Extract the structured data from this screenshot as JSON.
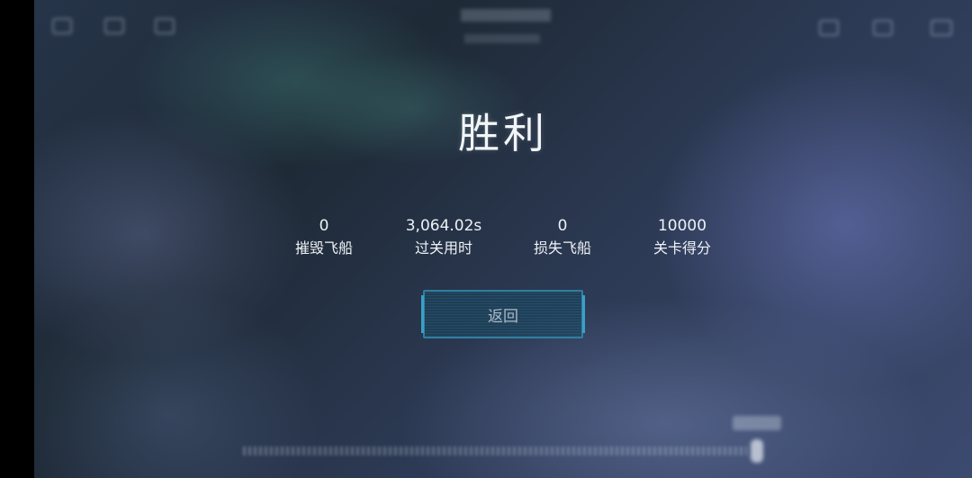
{
  "result": {
    "title": "胜利"
  },
  "stats": [
    {
      "value": "0",
      "label": "摧毁飞船"
    },
    {
      "value": "3,064.02s",
      "label": "过关用时"
    },
    {
      "value": "0",
      "label": "损失飞船"
    },
    {
      "value": "10000",
      "label": "关卡得分"
    }
  ],
  "actions": {
    "return_label": "返回"
  },
  "colors": {
    "button_border": "#2f7fa0",
    "text": "#eef2f6"
  }
}
